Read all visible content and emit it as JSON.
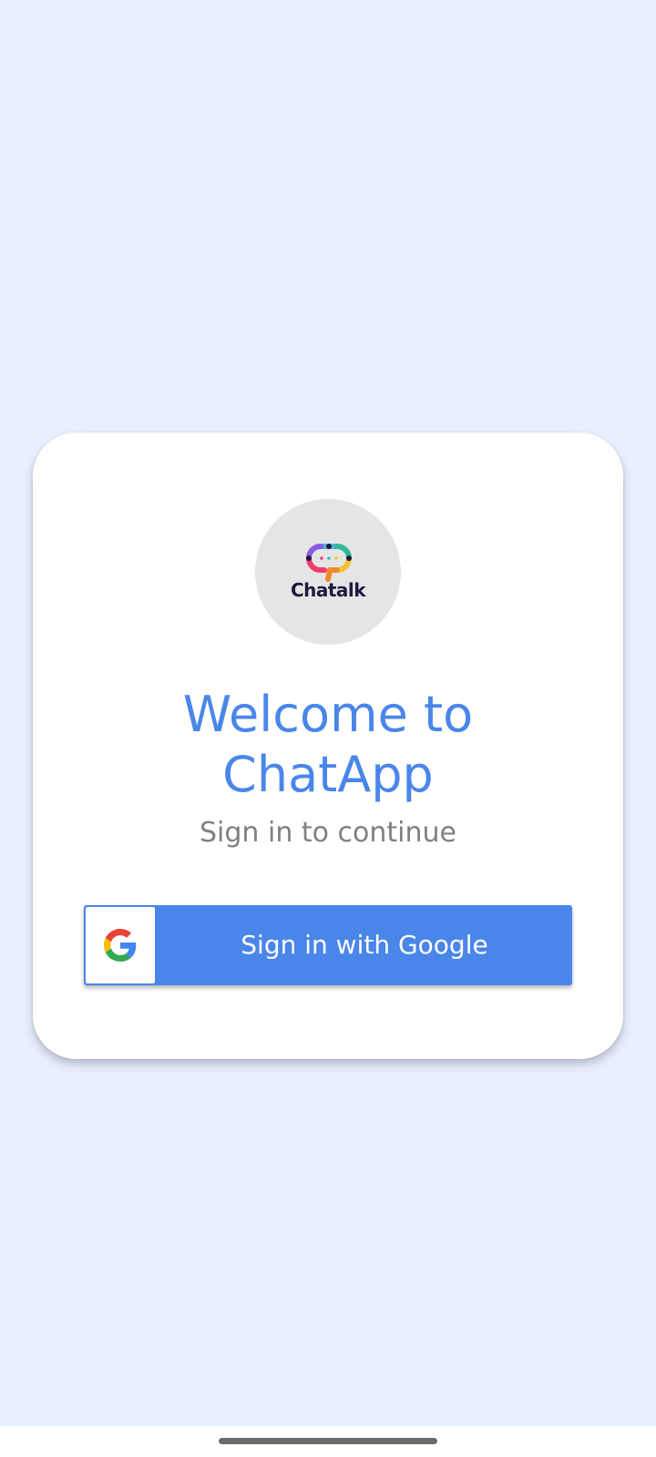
{
  "app": {
    "logo_text": "Chatalk",
    "title_line1": "Welcome to",
    "title_line2": "ChatApp",
    "subtitle": "Sign in to continue"
  },
  "signin_button": {
    "label": "Sign in with Google",
    "icon": "google-g-icon"
  },
  "colors": {
    "background": "#e8effd",
    "card": "#ffffff",
    "accent": "#4a86ea",
    "subtitle": "#808080",
    "logo_circle": "#e5e5e5"
  }
}
